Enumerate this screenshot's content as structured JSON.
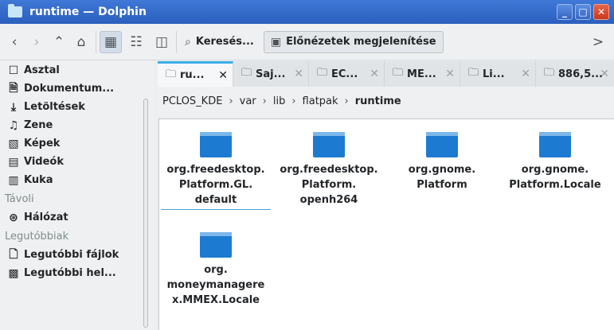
{
  "window": {
    "title": "runtime — Dolphin",
    "buttons": {
      "minimize": "_",
      "maximize": "□",
      "close": "✕"
    }
  },
  "toolbar": {
    "search_label": "Keresés...",
    "preview_label": "Előnézetek megjelenítése",
    "more_label": ">"
  },
  "sidebar": {
    "places": [
      {
        "label": "Asztal",
        "icon": "desktop-icon"
      },
      {
        "label": "Dokumentum...",
        "icon": "documents-icon"
      },
      {
        "label": "Letöltések",
        "icon": "downloads-icon"
      },
      {
        "label": "Zene",
        "icon": "music-icon"
      },
      {
        "label": "Képek",
        "icon": "pictures-icon"
      },
      {
        "label": "Videók",
        "icon": "videos-icon"
      },
      {
        "label": "Kuka",
        "icon": "trash-icon"
      }
    ],
    "remote_header": "Távoli",
    "remote": [
      {
        "label": "Hálózat",
        "icon": "network-icon"
      }
    ],
    "recent_header": "Legutóbbiak",
    "recent": [
      {
        "label": "Legutóbbi fájlok",
        "icon": "recent-files-icon"
      },
      {
        "label": "Legutóbbi hel...",
        "icon": "recent-locations-icon"
      }
    ]
  },
  "tabs": [
    {
      "label": "ru...",
      "active": true
    },
    {
      "label": "Saj...",
      "active": false
    },
    {
      "label": "EC...",
      "active": false
    },
    {
      "label": "ME...",
      "active": false
    },
    {
      "label": "Li...",
      "active": false
    },
    {
      "label": "886,5...",
      "active": false
    }
  ],
  "breadcrumb": [
    "PCLOS_KDE",
    "var",
    "lib",
    "flatpak",
    "runtime"
  ],
  "files": [
    {
      "name": "org.freedesktop.\nPlatform.GL.\ndefault",
      "selected": true
    },
    {
      "name": "org.freedesktop.\nPlatform.\nopenh264",
      "selected": false
    },
    {
      "name": "org.gnome.\nPlatform",
      "selected": false
    },
    {
      "name": "org.gnome.\nPlatform.Locale",
      "selected": false
    },
    {
      "name": "org.\nmoneymanagere\nx.MMEX.Locale",
      "selected": false
    }
  ],
  "colors": {
    "accent": "#3daee9",
    "folder": "#1c7bd0",
    "titlebar": "#2b5fbe"
  }
}
